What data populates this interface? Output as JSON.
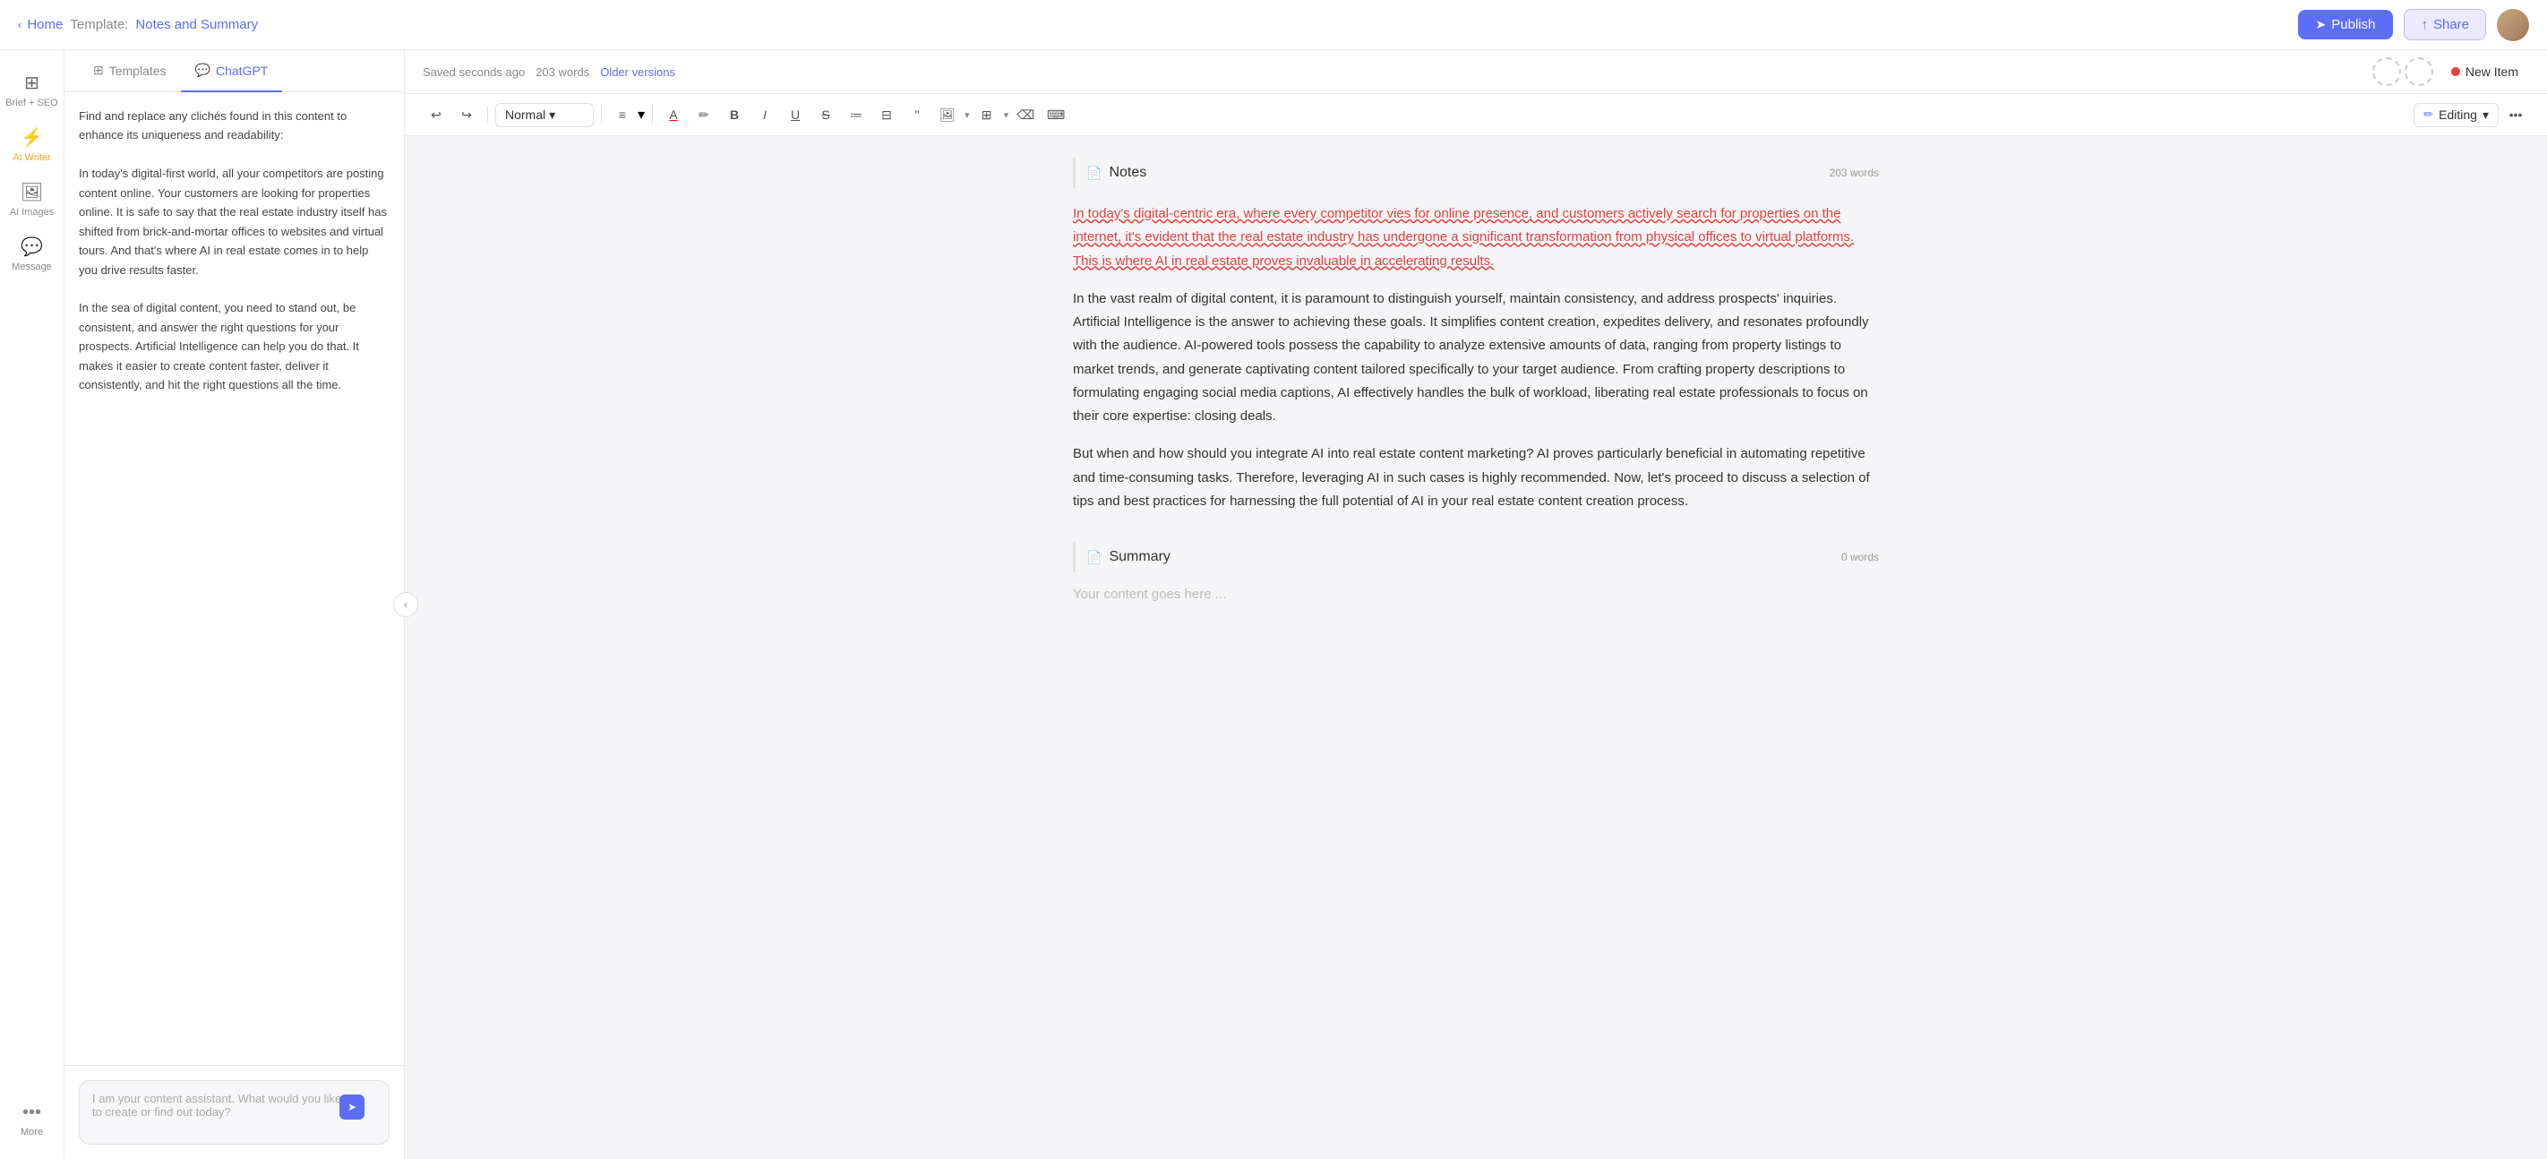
{
  "topnav": {
    "home_label": "Home",
    "template_prefix": "Template:",
    "template_name": "Notes and Summary",
    "publish_label": "Publish",
    "share_label": "Share"
  },
  "sidebar": {
    "items": [
      {
        "id": "brief-seo",
        "icon": "⚙",
        "label": "Brief + SEO",
        "active": false
      },
      {
        "id": "ai-writer",
        "icon": "⚡",
        "label": "AI Writer",
        "active": true
      },
      {
        "id": "ai-images",
        "icon": "🖼",
        "label": "AI Images",
        "active": false
      },
      {
        "id": "message",
        "icon": "💬",
        "label": "Message",
        "active": false
      },
      {
        "id": "more",
        "icon": "···",
        "label": "More",
        "active": false
      }
    ]
  },
  "panel": {
    "tabs": [
      {
        "id": "templates",
        "icon": "⊞",
        "label": "Templates"
      },
      {
        "id": "chatgpt",
        "icon": "💬",
        "label": "ChatGPT",
        "active": true
      }
    ],
    "content": "Find and replace any clichés found in this content to enhance its uniqueness and readability:\nIn today's digital-first world, all your competitors are posting content online. Your customers are looking for properties online. It is safe to say that the real estate industry itself has shifted from brick-and-mortar offices to websites and virtual tours. And that's where AI in real estate comes in to help you drive results faster.\n\nIn the sea of digital content, you need to stand out, be consistent, and answer the right questions for your prospects. Artificial Intelligence can help you do that. It makes it easier to create content faster, deliver it consistently, and hit the right questions all the time.",
    "chat_placeholder": "I am your content assistant. What would you like to create or find out today?"
  },
  "editor": {
    "saved_label": "Saved seconds ago",
    "words_count": "203 words",
    "older_versions": "Older versions",
    "new_item_label": "New Item",
    "toolbar": {
      "style_label": "Normal",
      "editing_label": "Editing"
    },
    "sections": [
      {
        "id": "notes",
        "icon": "📄",
        "title": "Notes",
        "word_count": "203 words",
        "paragraphs": [
          {
            "text": "In today's digital-centric era, where every competitor vies for online presence, and customers actively search for properties on the internet, it's evident that the real estate industry has undergone a significant transformation from physical offices to virtual platforms. This is where AI in real estate proves invaluable in accelerating results.",
            "style": "red-underline"
          },
          {
            "text": "In the vast realm of digital content, it is paramount to distinguish yourself, maintain consistency, and address prospects' inquiries. Artificial Intelligence is the answer to achieving these goals. It simplifies content creation, expedites delivery, and resonates profoundly with the audience. AI-powered tools possess the capability to analyze extensive amounts of data, ranging from property listings to market trends, and generate captivating content tailored specifically to your target audience. From crafting property descriptions to formulating engaging social media captions, AI effectively handles the bulk of workload, liberating real estate professionals to focus on their core expertise: closing deals.",
            "style": "normal"
          },
          {
            "text": "But when and how should you integrate AI into real estate content marketing? AI proves particularly beneficial in automating repetitive and time-consuming tasks. Therefore, leveraging AI in such cases is highly recommended. Now, let's proceed to discuss a selection of tips and best practices for harnessing the full potential of AI in your real estate content creation process.",
            "style": "normal"
          }
        ]
      },
      {
        "id": "summary",
        "icon": "📄",
        "title": "Summary",
        "word_count": "0 words",
        "placeholder": "Your content goes here ..."
      }
    ]
  }
}
